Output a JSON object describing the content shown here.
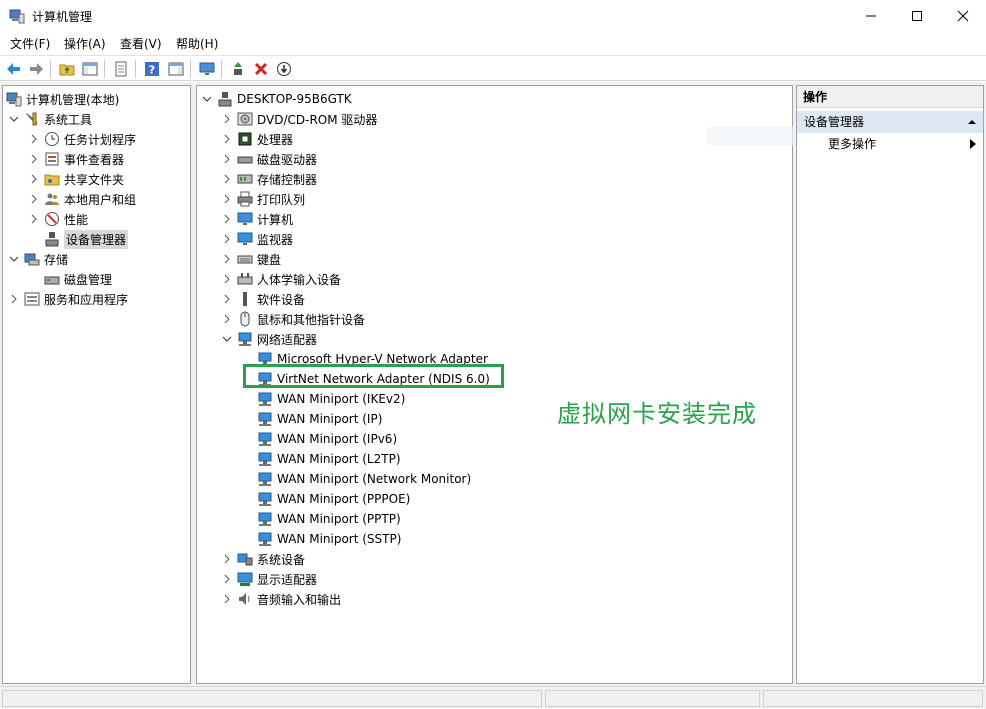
{
  "window": {
    "title": "计算机管理",
    "minimize": "—",
    "maximize": "☐",
    "close": "✕"
  },
  "menu": [
    "文件(F)",
    "操作(A)",
    "查看(V)",
    "帮助(H)"
  ],
  "toolbar": {
    "icons": [
      "back-icon",
      "forward-icon",
      "up-folder-icon",
      "show-hide-tree-icon",
      "properties-icon",
      "help-icon",
      "show-action-pane-icon",
      "display-icon",
      "update-driver-icon",
      "uninstall-icon",
      "disable-icon"
    ]
  },
  "left_tree": {
    "root": "计算机管理(本地)",
    "system_tools": "系统工具",
    "task_scheduler": "任务计划程序",
    "event_viewer": "事件查看器",
    "shared_folders": "共享文件夹",
    "local_users": "本地用户和组",
    "performance": "性能",
    "device_manager": "设备管理器",
    "storage": "存储",
    "disk_management": "磁盘管理",
    "services_apps": "服务和应用程序"
  },
  "device_tree": {
    "computer": "DESKTOP-95B6GTK",
    "categories": [
      "DVD/CD-ROM 驱动器",
      "处理器",
      "磁盘驱动器",
      "存储控制器",
      "打印队列",
      "计算机",
      "监视器",
      "键盘",
      "人体学输入设备",
      "软件设备",
      "鼠标和其他指针设备",
      "网络适配器"
    ],
    "network_adapters": [
      "Microsoft Hyper-V Network Adapter",
      "VirtNet Network Adapter (NDIS 6.0)",
      "WAN Miniport (IKEv2)",
      "WAN Miniport (IP)",
      "WAN Miniport (IPv6)",
      "WAN Miniport (L2TP)",
      "WAN Miniport (Network Monitor)",
      "WAN Miniport (PPPOE)",
      "WAN Miniport (PPTP)",
      "WAN Miniport (SSTP)"
    ],
    "trailing_categories": [
      "系统设备",
      "显示适配器",
      "音频输入和输出"
    ]
  },
  "annotation": "虚拟网卡安装完成",
  "actions": {
    "header": "操作",
    "group": "设备管理器",
    "more": "更多操作"
  },
  "colors": {
    "highlight": "#2ba14a",
    "actions_group_bg": "#dde8f4"
  }
}
